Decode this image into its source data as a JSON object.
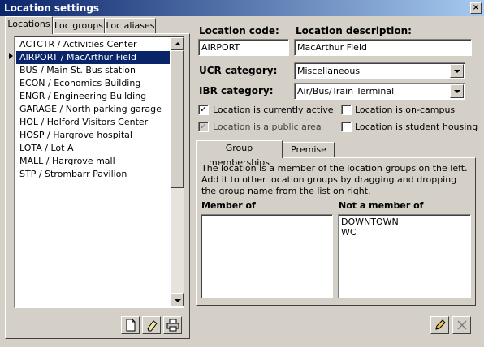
{
  "window": {
    "title": "Location settings",
    "close_glyph": "×"
  },
  "left_tabs": [
    "Locations",
    "Loc groups",
    "Loc aliases"
  ],
  "locations": [
    "ACTCTR / Activities Center",
    "AIRPORT / MacArthur Field",
    "BUS / Main St. Bus station",
    "ECON / Economics Building",
    "ENGR / Engineering Building",
    "GARAGE / North parking garage",
    "HOL / Holford Visitors Center",
    "HOSP / Hargrove hospital",
    "LOTA / Lot A",
    "MALL / Hargrove mall",
    "STP / Strombarr Pavilion"
  ],
  "selected_location_index": 1,
  "form": {
    "code_label": "Location code:",
    "code_value": "AIRPORT",
    "desc_label": "Location description:",
    "desc_value": "MacArthur Field",
    "ucr_label": "UCR category:",
    "ucr_value": "Miscellaneous",
    "ibr_label": "IBR category:",
    "ibr_value": "Air/Bus/Train Terminal"
  },
  "checkboxes": {
    "active": {
      "label": "Location is currently active",
      "checked": true
    },
    "on_campus": {
      "label": "Location is on-campus",
      "checked": false
    },
    "public": {
      "label": "Location is a public area",
      "checked": true
    },
    "student_housing": {
      "label": "Location is student housing",
      "checked": false
    }
  },
  "right_tabs": [
    "Group memberships",
    "Premise log"
  ],
  "group_info": "The location is a member of the location groups on the left.  Add it to other location groups by dragging and dropping the group name from the list on right.",
  "member_of_label": "Member of",
  "member_of": [],
  "not_member_label": "Not a member of",
  "not_member": [
    "DOWNTOWN",
    "WC"
  ],
  "icons": {
    "new": "new-document-icon",
    "erase": "eraser-icon",
    "print": "printer-icon",
    "edit": "pencil-icon",
    "cancel": "cancel-x-icon"
  }
}
